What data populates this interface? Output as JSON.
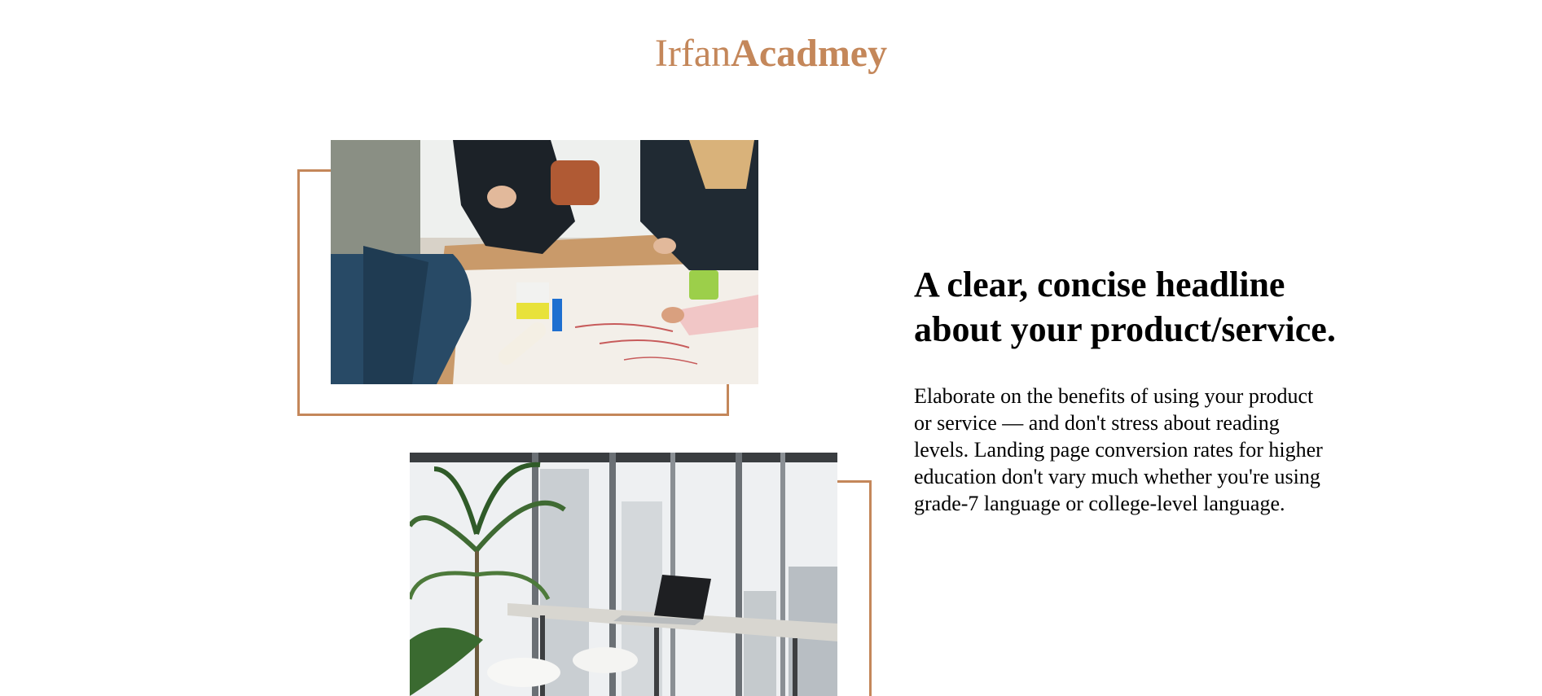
{
  "brand": {
    "light": "Irfan",
    "bold": "Acadmey",
    "accent_color": "#c4875a"
  },
  "images": [
    {
      "icon": "students-collaborating-photo"
    },
    {
      "icon": "office-workspace-photo"
    }
  ],
  "hero": {
    "headline": "A clear, concise headline about your product/service.",
    "body": "Elaborate on the benefits of using your product or service — and don't stress about reading levels. Landing page conversion rates for higher education don't vary much whether you're using grade-7 language or college-level language."
  }
}
